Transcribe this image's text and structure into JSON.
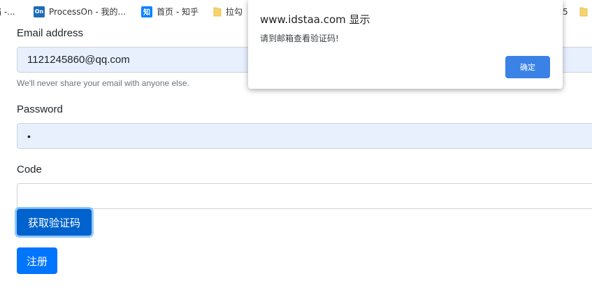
{
  "bookmarks": {
    "item0": {
      "label": "档 -..."
    },
    "item1": {
      "label": "ProcessOn - 我的...",
      "icon": "processon-icon",
      "icon_text": "On"
    },
    "item2": {
      "label": "首页 - 知乎",
      "icon": "zhihu-icon",
      "icon_text": "知"
    },
    "item3": {
      "label": "拉勾",
      "icon": "folder-icon"
    },
    "item4": {
      "label": "5",
      "icon": "folder-icon"
    }
  },
  "form": {
    "email_label": "Email address",
    "email_value": "1121245860@qq.com",
    "email_help": "We'll never share your email with anyone else.",
    "password_label": "Password",
    "password_value": "•",
    "code_label": "Code",
    "code_value": "",
    "get_code_button": "获取验证码",
    "register_button": "注册"
  },
  "dialog": {
    "title": "www.idstaa.com 显示",
    "message": "请到邮箱查看验证码!",
    "ok_button": "确定"
  },
  "colors": {
    "primary": "#0275ff",
    "primary_active": "#0062cc",
    "autofill_bg": "#e8f0fe",
    "dialog_button": "#3b82e6"
  }
}
